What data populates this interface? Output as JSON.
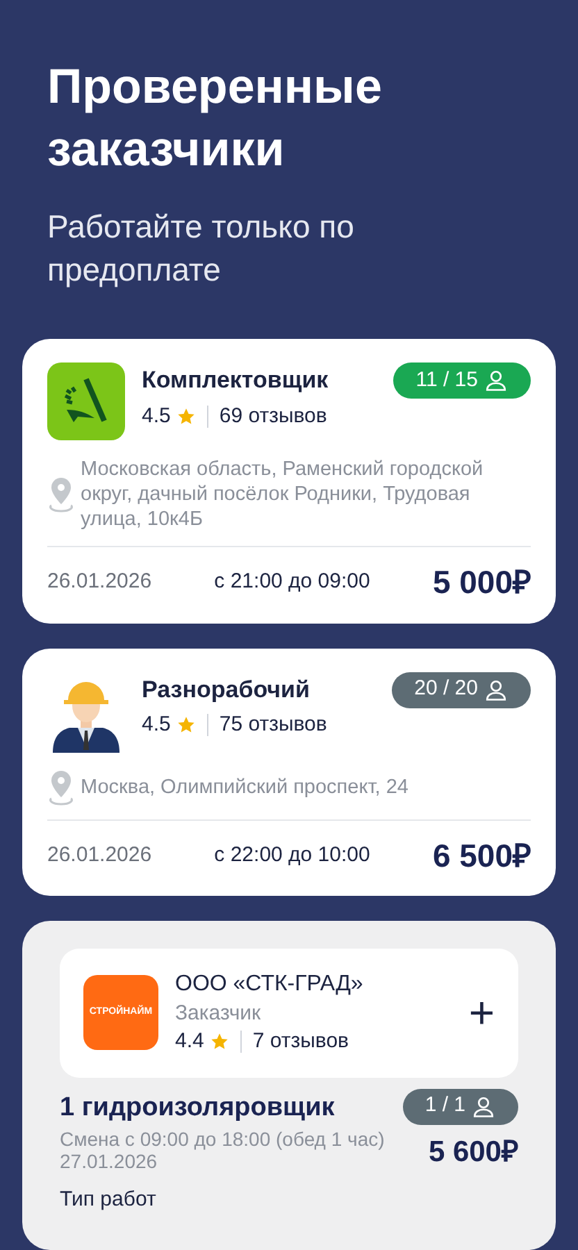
{
  "header": {
    "title": "Проверенные заказчики",
    "subtitle": "Работайте только по предоплате"
  },
  "jobs": [
    {
      "kind": "wheat",
      "title": "Комплектовщик",
      "rating": "4.5",
      "reviews": "69 отзывов",
      "badge": {
        "text": "11 / 15",
        "color": "#1aa853"
      },
      "address": "Московская область, Раменский городской округ, дачный посёлок Родники, Трудовая улица, 10к4Б",
      "date": "26.01.2026",
      "time": "с 21:00 до 09:00",
      "price": "5 000₽"
    },
    {
      "kind": "worker",
      "title": "Разнорабочий",
      "rating": "4.5",
      "reviews": "75 отзывов",
      "badge": {
        "text": "20 / 20",
        "color": "#5d6c74"
      },
      "address": "Москва, Олимпийский проспект, 24",
      "date": "26.01.2026",
      "time": "с 22:00 до 10:00",
      "price": "6 500₽"
    }
  ],
  "company_card": {
    "logo_text": "СТРОЙНАЙМ",
    "name": "ООО «СТК-ГРАД»",
    "role": "Заказчик",
    "rating": "4.4",
    "reviews": "7 отзывов",
    "add": "+",
    "title": "1 гидроизоляровщик",
    "shift": "Смена с 09:00 до 18:00 (обед 1 час)",
    "date": "27.01.2026",
    "badge": {
      "text": "1 / 1",
      "color": "#5d6c74"
    },
    "price": "5 600₽",
    "section_title": "Тип работ"
  }
}
